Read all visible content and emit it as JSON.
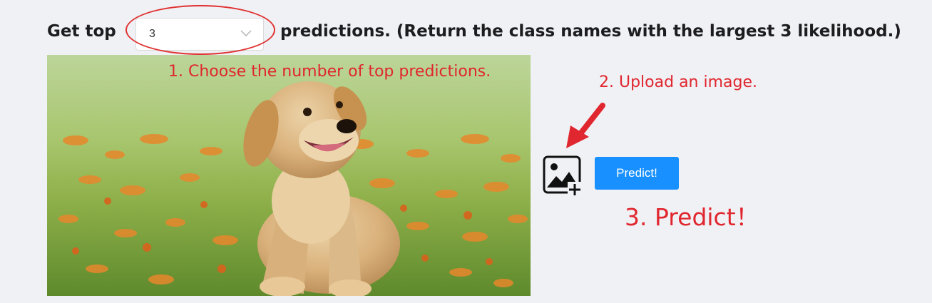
{
  "header": {
    "label_before": "Get top",
    "label_after": "predictions. (Return the class names with the largest 3 likelihood.)"
  },
  "top_k_select": {
    "value": "3",
    "icon": "chevron-down-icon"
  },
  "annotations": {
    "step1": "1. Choose the number of top predictions.",
    "step2": "2. Upload an image.",
    "step3": "3. Predict！"
  },
  "upload": {
    "icon": "image-add-icon"
  },
  "predict_button": {
    "label": "Predict!"
  },
  "colors": {
    "annotation_red": "#e0262e",
    "primary_blue": "#1890ff",
    "background": "#f0f1f5"
  }
}
